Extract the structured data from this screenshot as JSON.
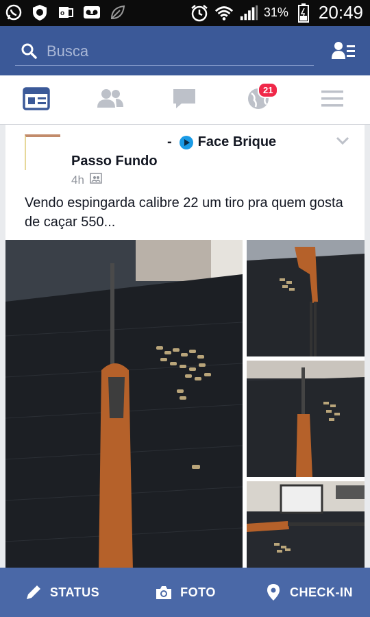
{
  "status_bar": {
    "battery_percent": "31%",
    "time": "20:49",
    "icons": [
      "whatsapp-icon",
      "shield-icon",
      "outlook-icon",
      "voicemail-icon",
      "leaf-icon",
      "alarm-icon",
      "wifi-icon",
      "signal-icon",
      "battery-icon"
    ]
  },
  "search": {
    "placeholder": "Busca"
  },
  "tabs": {
    "items": [
      "news-feed-icon",
      "friend-requests-icon",
      "messages-icon",
      "notifications-icon",
      "more-menu-icon"
    ],
    "notifications_badge": "21"
  },
  "post": {
    "header_prefix": "-",
    "page_name": "Face Brique",
    "group_name": "Passo Fundo",
    "time": "4h",
    "text": "Vendo espingarda calibre 22 um tiro pra quem gosta de caçar 550..."
  },
  "bottom_bar": {
    "status_label": "STATUS",
    "photo_label": "FOTO",
    "checkin_label": "CHECK-IN"
  },
  "colors": {
    "brand_blue": "#3b5998",
    "bottom_bar": "#4a68a7",
    "badge_red": "#f02849"
  }
}
